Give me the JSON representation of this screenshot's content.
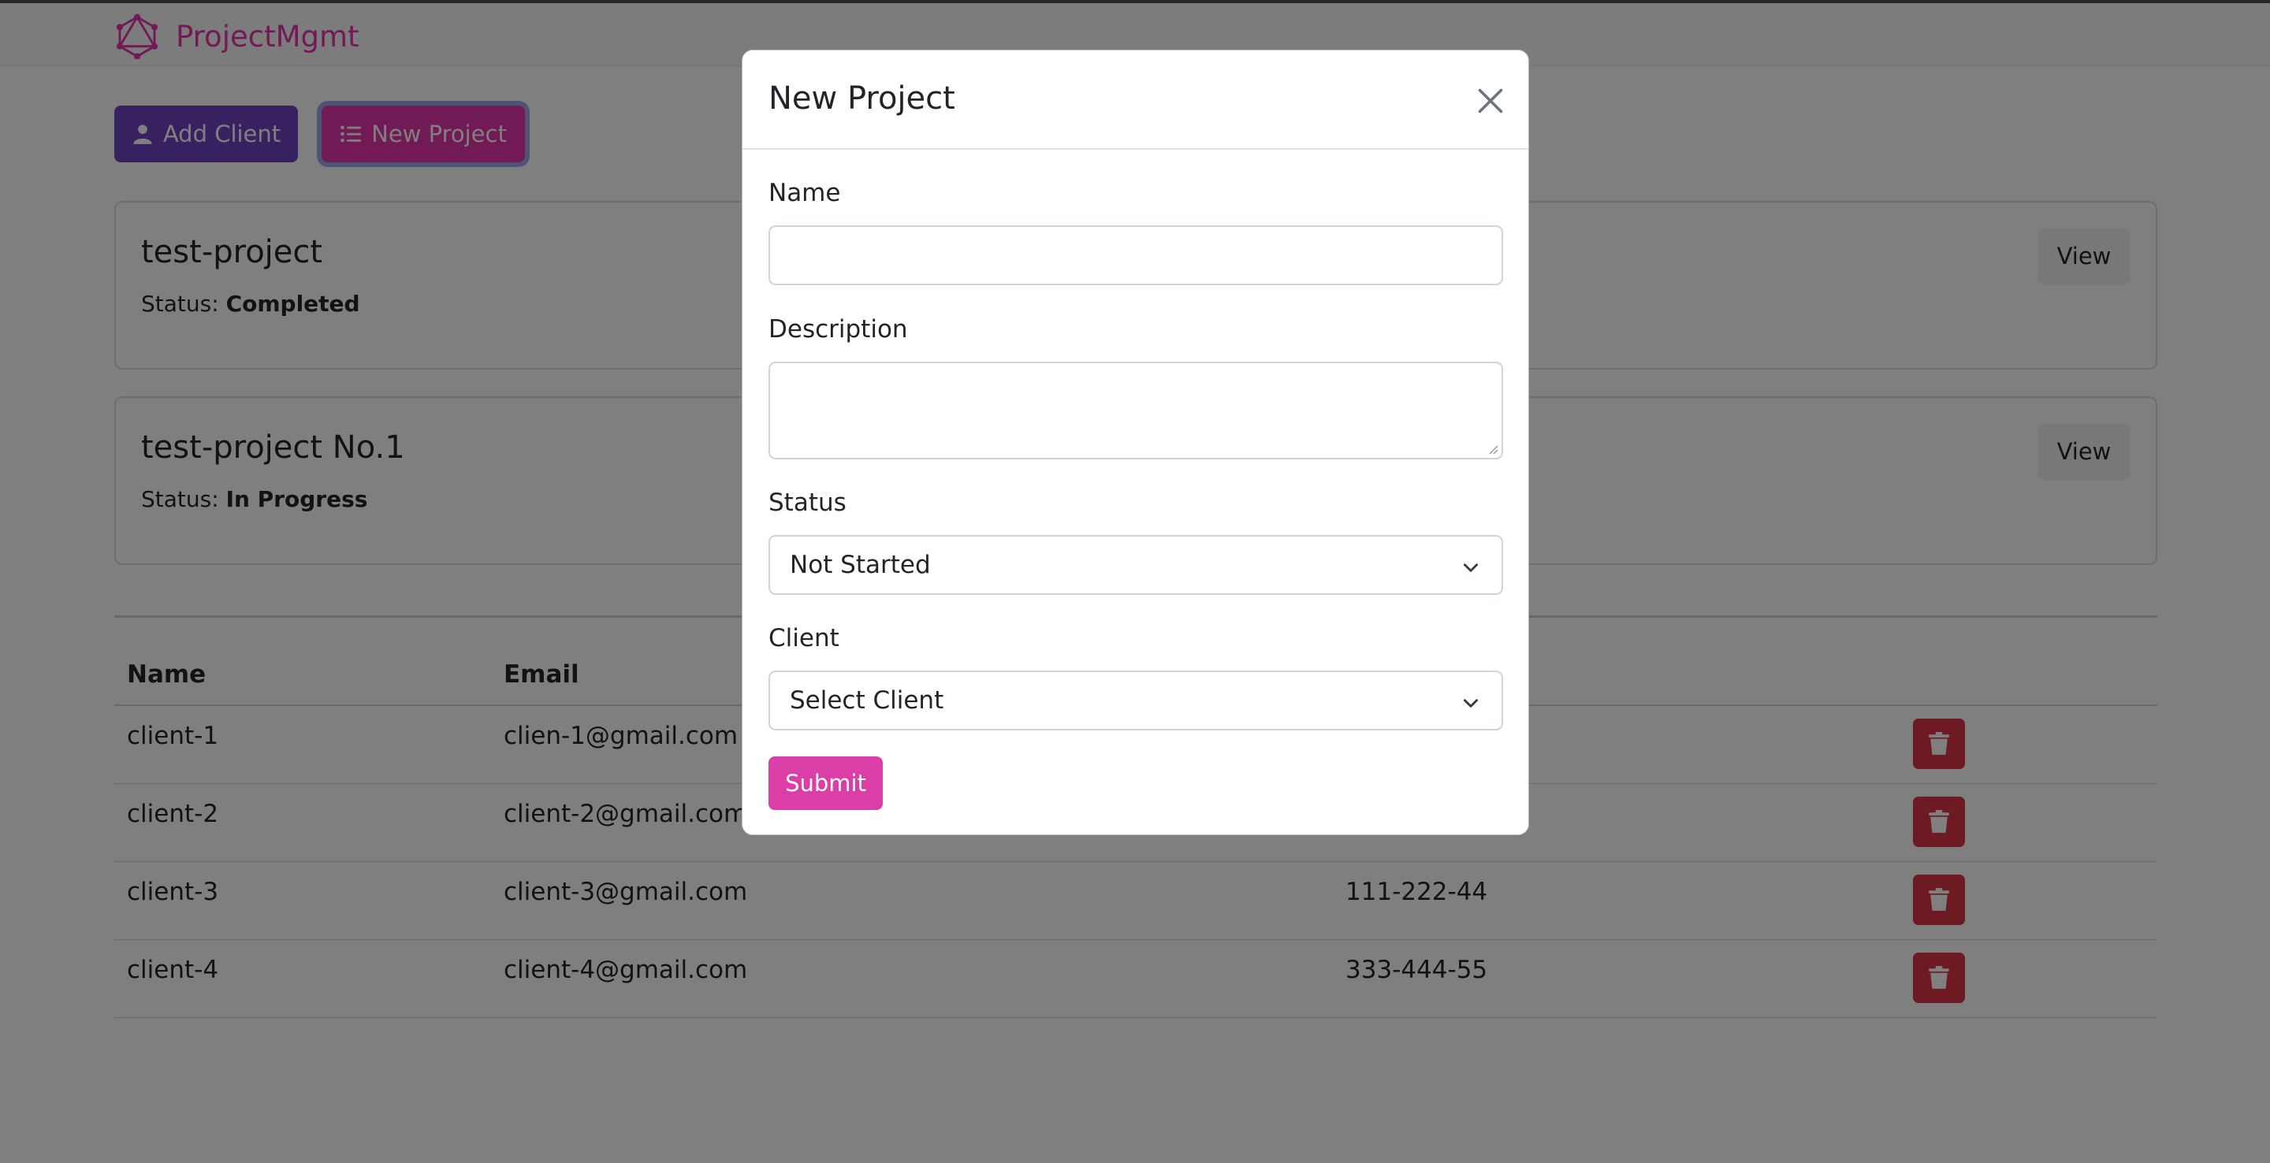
{
  "app": {
    "brand": "ProjectMgmt"
  },
  "toolbar": {
    "add_client": "Add Client",
    "new_project": "New Project"
  },
  "projects": [
    {
      "name": "test-project",
      "status_label": "Status:",
      "status": "Completed",
      "view": "View"
    },
    {
      "name": "test-project No.1",
      "status_label": "Status:",
      "status": "In Progress",
      "view": "View"
    }
  ],
  "clients_table": {
    "headers": [
      "Name",
      "Email"
    ],
    "rows": [
      {
        "name": "client-1",
        "email": "clien-1@gmail.com",
        "phone": ""
      },
      {
        "name": "client-2",
        "email": "client-2@gmail.com",
        "phone": ""
      },
      {
        "name": "client-3",
        "email": "client-3@gmail.com",
        "phone": "111-222-44"
      },
      {
        "name": "client-4",
        "email": "client-4@gmail.com",
        "phone": "333-444-55"
      }
    ]
  },
  "modal": {
    "title": "New Project",
    "name_label": "Name",
    "name_value": "",
    "description_label": "Description",
    "description_value": "",
    "status_label": "Status",
    "status_selected": "Not Started",
    "client_label": "Client",
    "client_selected": "Select Client",
    "submit": "Submit"
  },
  "colors": {
    "brand": "#e535ab",
    "add_client_btn": "#6f42c1",
    "new_project_btn": "#e535ab",
    "delete_btn": "#dc3545",
    "submit_btn": "#db3ea6"
  },
  "icons": [
    "graphql-logo-icon",
    "user-icon",
    "list-icon",
    "trash-icon",
    "close-icon",
    "chevron-down-icon"
  ]
}
